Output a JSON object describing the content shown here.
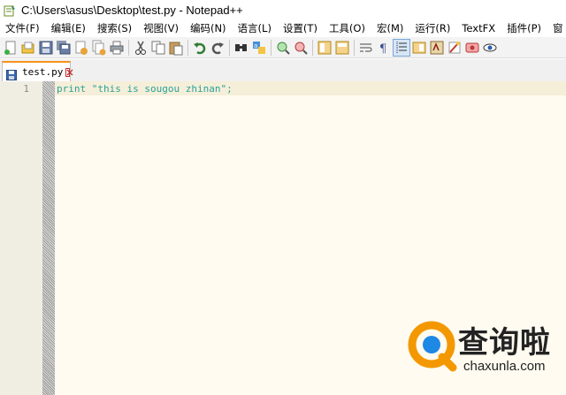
{
  "window": {
    "title": "C:\\Users\\asus\\Desktop\\test.py - Notepad++",
    "app_icon": "notepadpp-icon"
  },
  "menu": {
    "items": [
      {
        "label": "文件(F)"
      },
      {
        "label": "编辑(E)"
      },
      {
        "label": "搜索(S)"
      },
      {
        "label": "视图(V)"
      },
      {
        "label": "编码(N)"
      },
      {
        "label": "语言(L)"
      },
      {
        "label": "设置(T)"
      },
      {
        "label": "工具(O)"
      },
      {
        "label": "宏(M)"
      },
      {
        "label": "运行(R)"
      },
      {
        "label": "TextFX"
      },
      {
        "label": "插件(P)"
      },
      {
        "label": "窗"
      }
    ]
  },
  "toolbar": {
    "icons": [
      "new-file-icon",
      "open-file-icon",
      "save-icon",
      "save-all-icon",
      "close-icon",
      "close-all-icon",
      "print-icon",
      "cut-icon",
      "copy-icon",
      "paste-icon",
      "undo-icon",
      "redo-icon",
      "find-icon",
      "replace-icon",
      "zoom-in-icon",
      "zoom-out-icon",
      "sync-vertical-icon",
      "sync-horizontal-icon",
      "word-wrap-icon",
      "show-all-chars-icon",
      "indent-guide-icon",
      "doc-map-icon",
      "function-list-icon",
      "folder-workspace-icon",
      "macro-record-icon",
      "eye-icon"
    ]
  },
  "tabs": [
    {
      "label": "test.py",
      "active": true
    }
  ],
  "editor": {
    "line_number": "1",
    "code_keyword": "print",
    "code_string": "\"this is sougou zhinan\"",
    "code_end": ";"
  },
  "watermark": {
    "text_cn": "查询啦",
    "url": "chaxunla.com"
  },
  "colors": {
    "editor_bg": "#fffbf0",
    "code_text": "#2aa198",
    "tab_accent": "#f7931e",
    "watermark_orange": "#f39800",
    "watermark_blue": "#1e88e5"
  }
}
